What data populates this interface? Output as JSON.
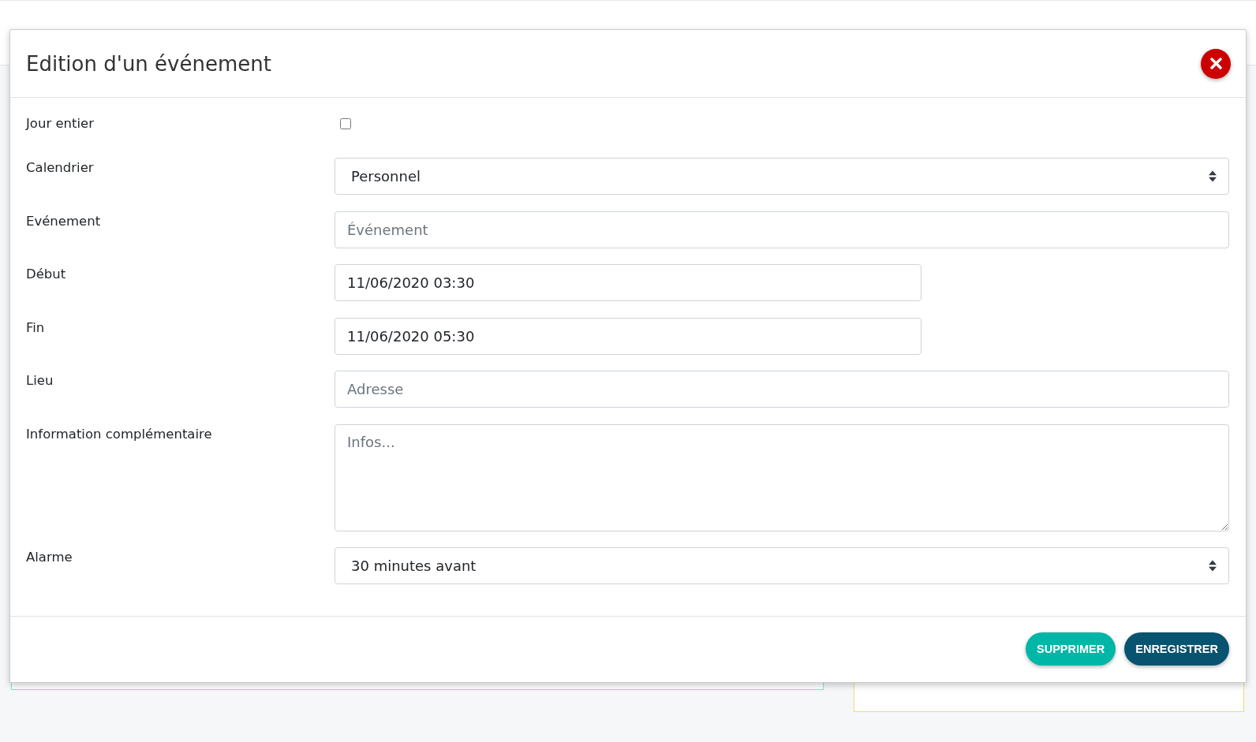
{
  "dialog": {
    "title": "Edition d'un événement",
    "fields": [
      {
        "kind": "checkbox",
        "label": "Jour entier",
        "checked": false
      },
      {
        "kind": "select",
        "label": "Calendrier",
        "value": "Personnel"
      },
      {
        "kind": "text",
        "label": "Evénement",
        "placeholder": "Événement"
      },
      {
        "kind": "datetime",
        "label": "Début",
        "value": "11/06/2020 03:30"
      },
      {
        "kind": "datetime",
        "label": "Fin",
        "value": "11/06/2020 05:30"
      },
      {
        "kind": "text",
        "label": "Lieu",
        "placeholder": "Adresse"
      },
      {
        "kind": "textarea",
        "label": "Information complémentaire",
        "placeholder": "Infos..."
      },
      {
        "kind": "select",
        "label": "Alarme",
        "value": "30 minutes avant"
      }
    ],
    "buttons": [
      {
        "kind": "delete",
        "label": "SUPPRIMER"
      },
      {
        "kind": "save",
        "label": "ENREGISTRER"
      }
    ]
  }
}
